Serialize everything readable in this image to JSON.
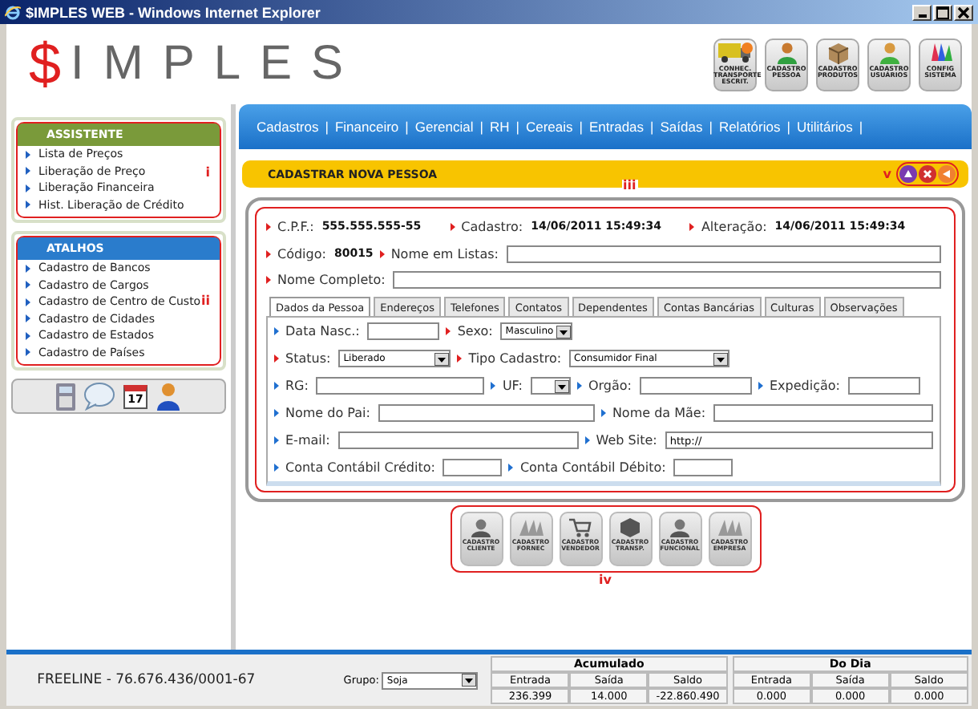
{
  "window": {
    "title": "$IMPLES WEB - Windows Internet Explorer"
  },
  "logo": {
    "symbol": "$",
    "name": "IMPLES"
  },
  "toolbar": [
    "CONHEC. TRANSPORTE ESCRIT.",
    "CADASTRO PESSOA",
    "CADASTRO PRODUTOS",
    "CADASTRO USUÁRIOS",
    "CONFIG SISTEMA"
  ],
  "sidebar": {
    "panels": [
      {
        "title": "ASSISTENTE",
        "color": "#7a9a3a",
        "annotation": "i",
        "items": [
          "Lista de Preços",
          "Liberação de Preço",
          "Liberação Financeira",
          "Hist. Liberação de Crédito"
        ]
      },
      {
        "title": "ATALHOS",
        "color": "#2a7ccc",
        "annotation": "ii",
        "items": [
          "Cadastro de Bancos",
          "Cadastro de Cargos",
          "Cadastro de Centro de Custo",
          "Cadastro de Cidades",
          "Cadastro de Estados",
          "Cadastro de Países"
        ]
      }
    ],
    "calendar_day": "17"
  },
  "nav": {
    "separator": "|",
    "items": [
      "Cadastros",
      "Financeiro",
      "Gerencial",
      "RH",
      "Cereais",
      "Entradas",
      "Saídas",
      "Relatórios",
      "Utilitários"
    ]
  },
  "panel": {
    "title": "CADASTRAR NOVA PESSOA",
    "annotation": "iii",
    "controls_annotation": "v",
    "info": [
      [
        {
          "label": "C.P.F.:",
          "value": "555.555.555-55"
        },
        {
          "label": "Cadastro:",
          "value": "14/06/2011 15:49:34"
        },
        {
          "label": "Alteração:",
          "value": "14/06/2011 15:49:34"
        }
      ],
      [
        {
          "label": "Código:",
          "value": "80015"
        }
      ]
    ],
    "nome_listas": {
      "label": "Nome em Listas:"
    },
    "nome_completo": {
      "label": "Nome Completo:"
    },
    "tabs": [
      {
        "label": "Dados da Pessoa",
        "selected": true
      },
      {
        "label": "Endereços",
        "selected": false
      },
      {
        "label": "Telefones",
        "selected": false
      },
      {
        "label": "Contatos",
        "selected": false
      },
      {
        "label": "Dependentes",
        "selected": false
      },
      {
        "label": "Contas Bancárias",
        "selected": false
      },
      {
        "label": "Culturas",
        "selected": false
      },
      {
        "label": "Observações",
        "selected": false
      }
    ],
    "rows": [
      [
        {
          "label": "Data Nasc.:",
          "required": false,
          "kind": "input"
        },
        {
          "label": "Sexo:",
          "required": true,
          "kind": "select",
          "value": "Masculino"
        }
      ],
      [
        {
          "label": "Status:",
          "required": true,
          "kind": "select",
          "value": "Liberado"
        },
        {
          "label": "Tipo Cadastro:",
          "required": true,
          "kind": "select",
          "value": "Consumidor Final"
        }
      ],
      [
        {
          "label": "RG:",
          "required": false,
          "kind": "input"
        },
        {
          "label": "UF:",
          "required": false,
          "kind": "select"
        },
        {
          "label": "Orgão:",
          "required": false,
          "kind": "input"
        },
        {
          "label": "Expedição:",
          "required": false,
          "kind": "input"
        }
      ],
      [
        {
          "label": "Nome do Pai:",
          "required": false,
          "kind": "input"
        },
        {
          "label": "Nome da Mãe:",
          "required": false,
          "kind": "input"
        }
      ],
      [
        {
          "label": "E-mail:",
          "required": false,
          "kind": "input"
        },
        {
          "label": "Web Site:",
          "required": false,
          "kind": "input",
          "value": "http://"
        }
      ],
      [
        {
          "label": "Conta Contábil Crédito:",
          "required": false,
          "kind": "input"
        },
        {
          "label": "Conta Contábil Débito:",
          "required": false,
          "kind": "input"
        }
      ]
    ]
  },
  "shortcuts": {
    "annotation": "iv",
    "buttons": [
      "CADASTRO CLIENTE",
      "CADASTRO FORNEC",
      "CADASTRO VENDEDOR",
      "CADASTRO TRANSP.",
      "CADASTRO FUNCIONAL",
      "CADASTRO EMPRESA"
    ]
  },
  "footer": {
    "company": "FREELINE - 76.676.436/0001-67",
    "group_label": "Grupo:",
    "group_value": "Soja",
    "tables": [
      {
        "title": "Acumulado",
        "columns": [
          "Entrada",
          "Saída",
          "Saldo"
        ],
        "values": [
          "236.399",
          "14.000",
          "-22.860.490"
        ]
      },
      {
        "title": "Do Dia",
        "columns": [
          "Entrada",
          "Saída",
          "Saldo"
        ],
        "values": [
          "0.000",
          "0.000",
          "0.000"
        ]
      }
    ]
  }
}
